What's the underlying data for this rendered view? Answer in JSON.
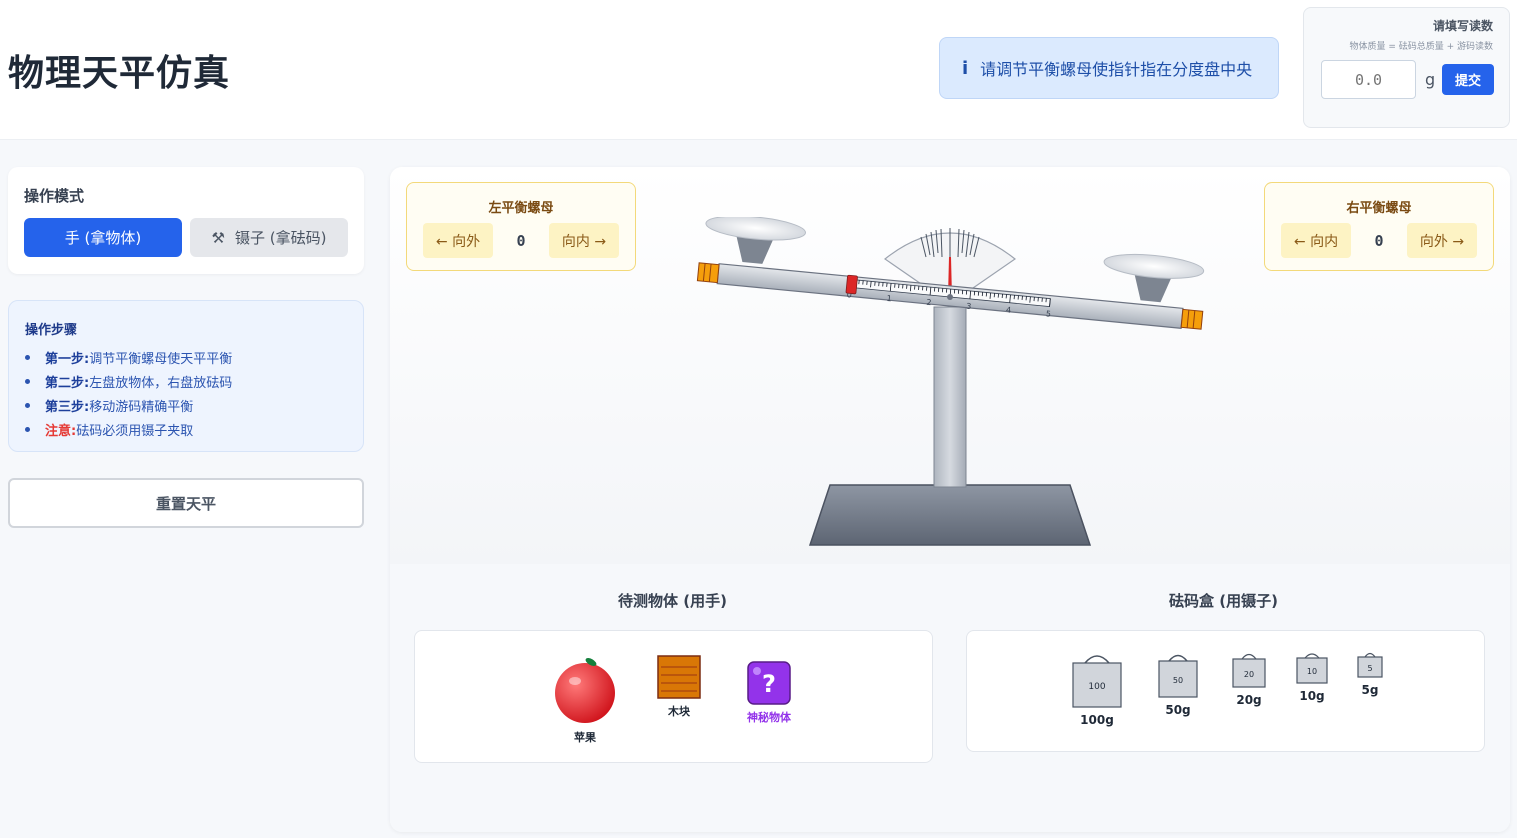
{
  "header": {
    "title": "物理天平仿真",
    "hint": "请调节平衡螺母使指针指在分度盘中央",
    "reading": {
      "title": "请填写读数",
      "formula": "物体质量 = 砝码总质量 + 游码读数",
      "input_placeholder": "0.0",
      "unit": "g",
      "submit_label": "提交"
    }
  },
  "sidebar": {
    "mode_title": "操作模式",
    "mode_hand_label": "手 (拿物体)",
    "mode_tweezers_label": "镊子 (拿砝码)",
    "steps_title": "操作步骤",
    "steps": [
      {
        "label": "第一步:",
        "text": "调节平衡螺母使天平平衡"
      },
      {
        "label": "第二步:",
        "text": "左盘放物体，右盘放砝码"
      },
      {
        "label": "第三步:",
        "text": "移动游码精确平衡"
      },
      {
        "label": "注意:",
        "text": "砝码必须用镊子夹取"
      }
    ],
    "reset_label": "重置天平"
  },
  "stage": {
    "left_nut": {
      "title": "左平衡螺母",
      "out_label": "← 向外",
      "in_label": "向内 →",
      "value": "0"
    },
    "right_nut": {
      "title": "右平衡螺母",
      "in_label": "← 向内",
      "out_label": "向外 →",
      "value": "0"
    },
    "beam_scale_labels": [
      "0",
      "1",
      "2",
      "3",
      "4",
      "5"
    ],
    "pointer_offset": 0,
    "rider_position_g": 0
  },
  "objects": {
    "title": "待测物体 (用手)",
    "items": [
      {
        "name": "苹果",
        "icon": "apple-icon"
      },
      {
        "name": "木块",
        "icon": "wood-block-icon"
      },
      {
        "name": "神秘物体",
        "icon": "mystery-box-icon",
        "symbol": "?"
      }
    ]
  },
  "weights": {
    "title": "砝码盒 (用镊子)",
    "items": [
      {
        "mark": "100",
        "label": "100g"
      },
      {
        "mark": "50",
        "label": "50g"
      },
      {
        "mark": "20",
        "label": "20g"
      },
      {
        "mark": "10",
        "label": "10g"
      },
      {
        "mark": "5",
        "label": "5g"
      }
    ]
  },
  "colors": {
    "primary": "#2563eb",
    "hint_bg": "#dbeafe",
    "nut_bg": "#fffdf3",
    "warning": "#e53935",
    "mystery": "#9333ea"
  }
}
